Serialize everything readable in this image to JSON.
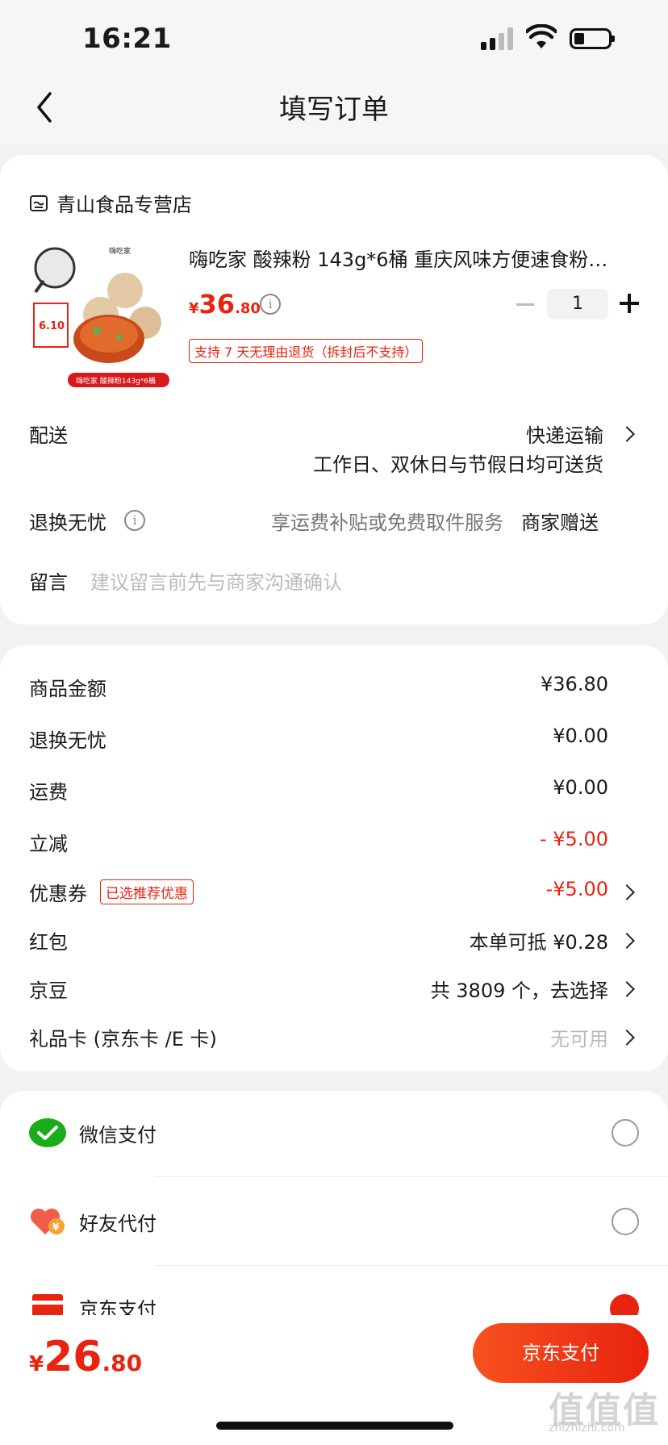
{
  "status_bar": {
    "time": "16:21"
  },
  "nav": {
    "title": "填写订单"
  },
  "store": {
    "name": "青山食品专营店"
  },
  "product": {
    "title": "嗨吃家 酸辣粉 143g*6桶 重庆风味方便速食粉…",
    "price_yen": "¥",
    "price_int": "36",
    "price_dec": ".80",
    "quantity": "1",
    "return_tag": "支持 7 天无理由退货（拆封后不支持）",
    "img_brand": "嗨吃家",
    "img_caption": "嗨吃家 酸辣粉143g*6桶",
    "img_badge_price": "6.10"
  },
  "delivery": {
    "label": "配送",
    "method": "快递运输",
    "note": "工作日、双休日与节假日均可送货"
  },
  "worry_free": {
    "label": "退换无忧",
    "desc": "享运费补贴或免费取件服务",
    "value": "商家赠送"
  },
  "message": {
    "label": "留言",
    "placeholder": "建议留言前先与商家沟通确认"
  },
  "summary": {
    "goods_label": "商品金额",
    "goods_value": "¥36.80",
    "worry_label": "退换无忧",
    "worry_value": "¥0.00",
    "shipping_label": "运费",
    "shipping_value": "¥0.00",
    "instant_label": "立减",
    "instant_value": "- ¥5.00",
    "coupon_label": "优惠券",
    "coupon_tag": "已选推荐优惠",
    "coupon_value": "-¥5.00",
    "redpack_label": "红包",
    "redpack_value": "本单可抵 ¥0.28",
    "jdbean_label": "京豆",
    "jdbean_value": "共 3809 个，去选择",
    "giftcard_label": "礼品卡 (京东卡 /E 卡)",
    "giftcard_value": "无可用"
  },
  "payment": {
    "wechat": "微信支付",
    "friend": "好友代付",
    "jd": "京东支付"
  },
  "footer": {
    "total_yen": "¥",
    "total_int": "26",
    "total_dec": ".80",
    "pay_button": "京东支付"
  },
  "watermark": {
    "main": "值值值",
    "sub": "zhizhizhi.com"
  },
  "colors": {
    "accent": "#e8230f",
    "wechat_green": "#1aad19"
  }
}
